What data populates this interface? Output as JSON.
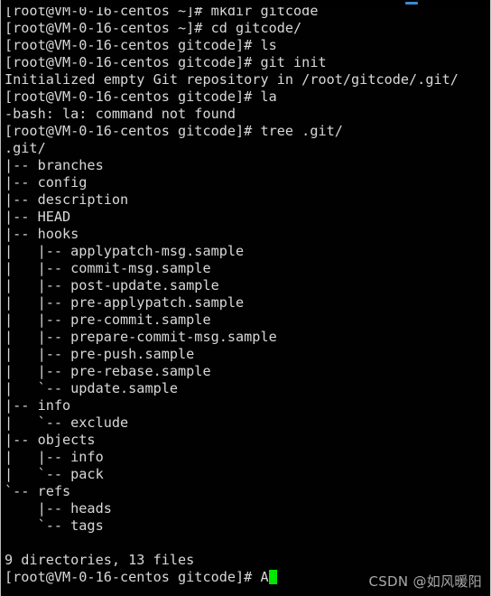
{
  "window": {
    "app_name": "Terminal",
    "titlebar": {
      "minimize_glyph": "minimize-dash-icon",
      "minimize_color": "#3c89d6"
    }
  },
  "theme": {
    "background": "#010101",
    "foreground": "#d8d8d8",
    "cursor": "#00e800",
    "watermark": "#a9a9a9"
  },
  "shell": {
    "prompt_home": "[root@VM-0-16-centos ~]#",
    "prompt_gitcode": "[root@VM-0-16-centos gitcode]#",
    "cursor_char": "A"
  },
  "terminal": {
    "lines": [
      "[root@VM-0-16-centos ~]# mkdir gitcode",
      "[root@VM-0-16-centos ~]# cd gitcode/",
      "[root@VM-0-16-centos gitcode]# ls",
      "[root@VM-0-16-centos gitcode]# git init",
      "Initialized empty Git repository in /root/gitcode/.git/",
      "[root@VM-0-16-centos gitcode]# la",
      "-bash: la: command not found",
      "[root@VM-0-16-centos gitcode]# tree .git/",
      ".git/",
      "|-- branches",
      "|-- config",
      "|-- description",
      "|-- HEAD",
      "|-- hooks",
      "|   |-- applypatch-msg.sample",
      "|   |-- commit-msg.sample",
      "|   |-- post-update.sample",
      "|   |-- pre-applypatch.sample",
      "|   |-- pre-commit.sample",
      "|   |-- prepare-commit-msg.sample",
      "|   |-- pre-push.sample",
      "|   |-- pre-rebase.sample",
      "|   `-- update.sample",
      "|-- info",
      "|   `-- exclude",
      "|-- objects",
      "|   |-- info",
      "|   `-- pack",
      "`-- refs",
      "    |-- heads",
      "    `-- tags",
      "",
      "9 directories, 13 files"
    ],
    "final_prompt": "[root@VM-0-16-centos gitcode]# A",
    "summary": {
      "directories": 9,
      "files": 13,
      "summary_text": "9 directories, 13 files"
    },
    "commands_run": [
      "mkdir gitcode",
      "cd gitcode/",
      "ls",
      "git init",
      "la",
      "tree .git/"
    ],
    "errors": [
      "-bash: la: command not found"
    ]
  },
  "watermark": {
    "text": "CSDN @如风暖阳"
  }
}
